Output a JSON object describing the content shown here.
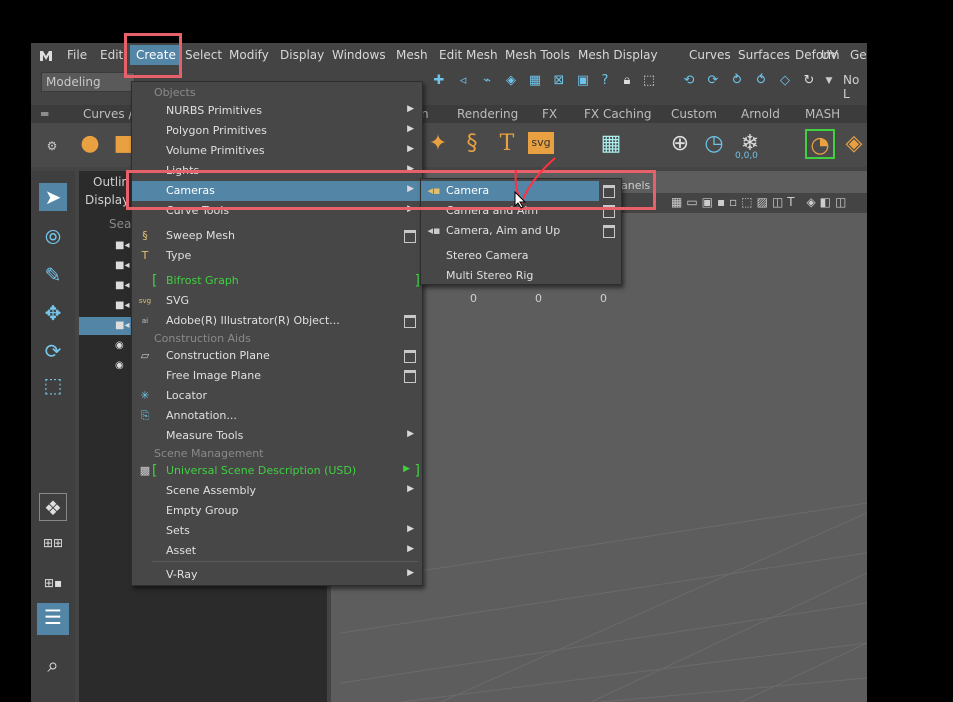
{
  "menubar": {
    "items": [
      "File",
      "Edit",
      "Create",
      "Select",
      "Modify",
      "Display",
      "Windows",
      "Mesh",
      "Edit Mesh",
      "Mesh Tools",
      "Mesh Display",
      "Curves",
      "Surfaces",
      "Deform",
      "UV",
      "Ge"
    ]
  },
  "toolbar": {
    "mode": "Modeling",
    "right_label": "No L"
  },
  "shelf": {
    "tabs": [
      "Curves / S",
      "n",
      "Rendering",
      "FX",
      "FX Caching",
      "Custom",
      "Arnold",
      "MASH"
    ],
    "svg_label": "svg",
    "counter": "0,0,0"
  },
  "outliner": {
    "title": "Outlin",
    "display": "Display",
    "search": "Sea"
  },
  "viewport": {
    "panels_label": "anels",
    "values": [
      "0",
      "0",
      "0"
    ]
  },
  "create_menu": {
    "sections": {
      "objects": "Objects",
      "construction": "Construction Aids",
      "scene": "Scene Management"
    },
    "items": {
      "nurbs": "NURBS Primitives",
      "polygon": "Polygon Primitives",
      "volume": "Volume Primitives",
      "lights": "Lights",
      "cameras": "Cameras",
      "curve_tools": "Curve Tools",
      "sweep_mesh": "Sweep Mesh",
      "type": "Type",
      "bifrost": "Bifrost Graph",
      "svg": "SVG",
      "illustrator": "Adobe(R) Illustrator(R) Object...",
      "construction_plane": "Construction Plane",
      "free_image_plane": "Free Image Plane",
      "locator": "Locator",
      "annotation": "Annotation...",
      "measure_tools": "Measure Tools",
      "usd": "Universal Scene Description (USD)",
      "scene_assembly": "Scene Assembly",
      "empty_group": "Empty Group",
      "sets": "Sets",
      "asset": "Asset",
      "vray": "V-Ray"
    }
  },
  "camera_submenu": {
    "items": [
      "Camera",
      "Camera and Aim",
      "Camera, Aim and Up",
      "Stereo Camera",
      "Multi Stereo Rig"
    ]
  },
  "colors": {
    "highlight": "#5285a6",
    "annotation_red": "#e8606a",
    "green_text": "#40d040"
  }
}
